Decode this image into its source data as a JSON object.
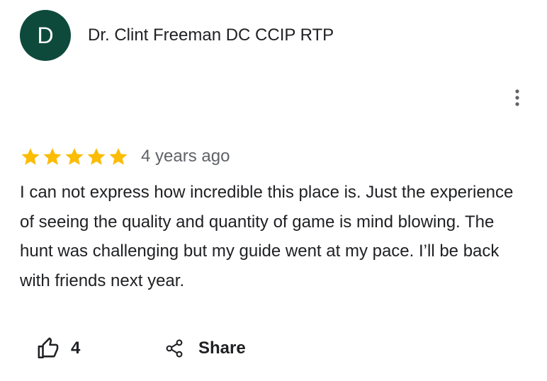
{
  "review": {
    "author": {
      "initial": "D",
      "name": "Dr. Clint Freeman DC CCIP RTP",
      "avatar_color": "#0d4a3c"
    },
    "rating": 5,
    "star_color": "#fbbc04",
    "date": "4 years ago",
    "text": "I can not express how incredible this place is. Just the experience of seeing the quality and quantity of game is mind blowing. The hunt was challenging but my guide went at my pace. I’ll be back with friends next year.",
    "more_icon": "more-vert-icon"
  },
  "actions": {
    "like": {
      "icon": "thumb-up-icon",
      "count": "4"
    },
    "share": {
      "icon": "share-icon",
      "label": "Share"
    }
  }
}
